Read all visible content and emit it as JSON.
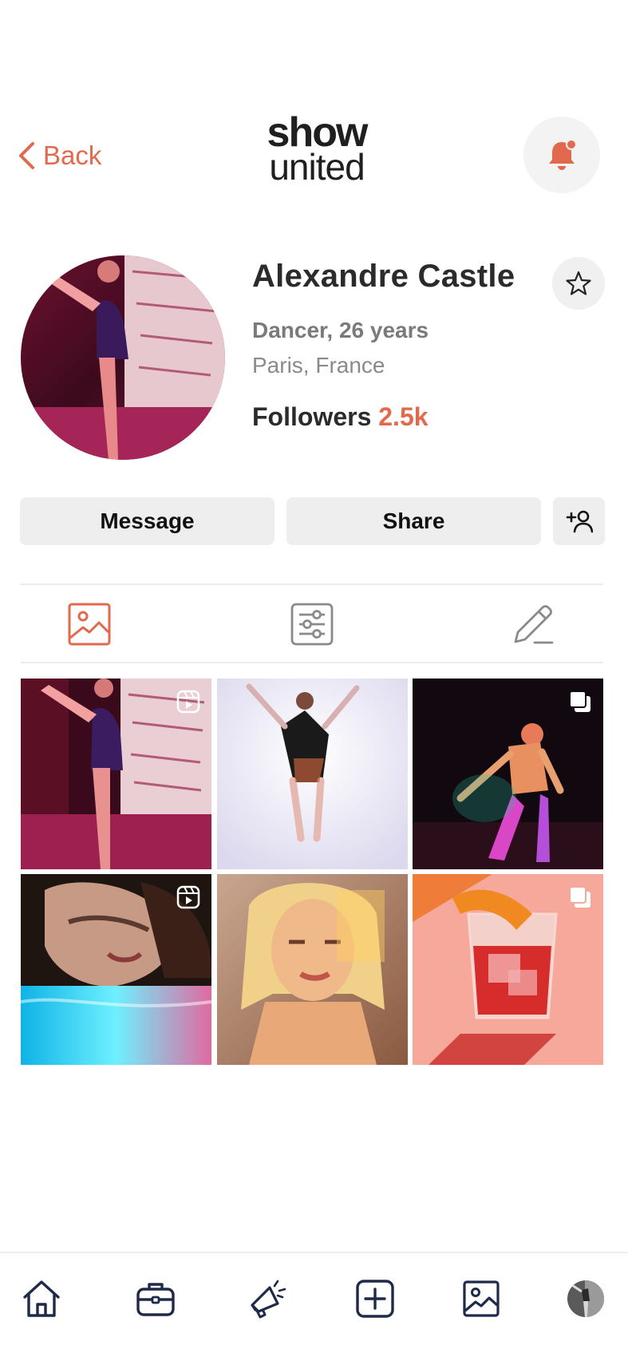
{
  "header": {
    "back_label": "Back",
    "logo_line1": "show",
    "logo_line2": "united"
  },
  "profile": {
    "name": "Alexandre Castle",
    "role": "Dancer, 26 years",
    "location": "Paris, France",
    "followers_label": "Followers",
    "followers_count": "2.5k"
  },
  "actions": {
    "message_label": "Message",
    "share_label": "Share",
    "add_icon": "add-user-icon"
  },
  "tabs": [
    {
      "icon": "image-icon",
      "active": true
    },
    {
      "icon": "sliders-icon",
      "active": false
    },
    {
      "icon": "pencil-icon",
      "active": false
    }
  ],
  "grid": [
    {
      "subject": "dancer leg raised, pink stage",
      "badge": "reel-icon"
    },
    {
      "subject": "dancer jumping, white background",
      "badge": "none"
    },
    {
      "subject": "dancer neon light",
      "badge": "multiple-icon"
    },
    {
      "subject": "woman face in water",
      "badge": "reel-icon"
    },
    {
      "subject": "blonde woman portrait, warm light",
      "badge": "none"
    },
    {
      "subject": "cocktail glass with orange peel",
      "badge": "multiple-icon"
    }
  ],
  "bottom_nav": [
    {
      "icon": "home-icon"
    },
    {
      "icon": "briefcase-icon"
    },
    {
      "icon": "megaphone-icon"
    },
    {
      "icon": "add-icon"
    },
    {
      "icon": "gallery-icon"
    },
    {
      "icon": "profile-avatar"
    }
  ],
  "colors": {
    "accent": "#E2694D",
    "button_bg": "#EEEEEE",
    "text_dark": "#2B2B2B",
    "text_muted": "#7A7A7A"
  }
}
